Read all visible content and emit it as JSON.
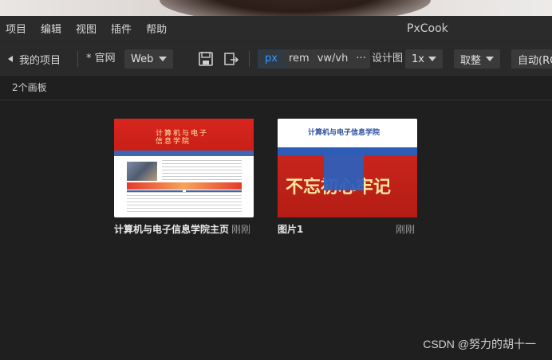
{
  "app": {
    "title": "PxCook"
  },
  "menu": [
    "项目",
    "编辑",
    "视图",
    "插件",
    "帮助"
  ],
  "toolbar": {
    "back_label": "我的项目",
    "project_name": "* 官网",
    "platform": "Web",
    "units": [
      "px",
      "rem",
      "vw/vh"
    ],
    "active_unit": "px",
    "more": "···",
    "design_label": "设计图",
    "scale": "1x",
    "rounding": "取整",
    "color_mode": "自动(RG"
  },
  "subbar": {
    "count_label": "2个画板"
  },
  "artboards": [
    {
      "name": "计算机与电子信息学院主页",
      "time": "刚刚",
      "thumb_text": "计算机与电子信息学院"
    },
    {
      "name": "图片1",
      "time": "刚刚",
      "thumb_header": "计算机与电子信息学院",
      "thumb_banner": "不忘初心牢记"
    }
  ],
  "watermark": "CSDN @努力的胡十一",
  "colors": {
    "background": "#1f1f1f",
    "menubar": "#2b2b2b",
    "toolbar": "#2a2a2a",
    "accent": "#2f9bff"
  }
}
